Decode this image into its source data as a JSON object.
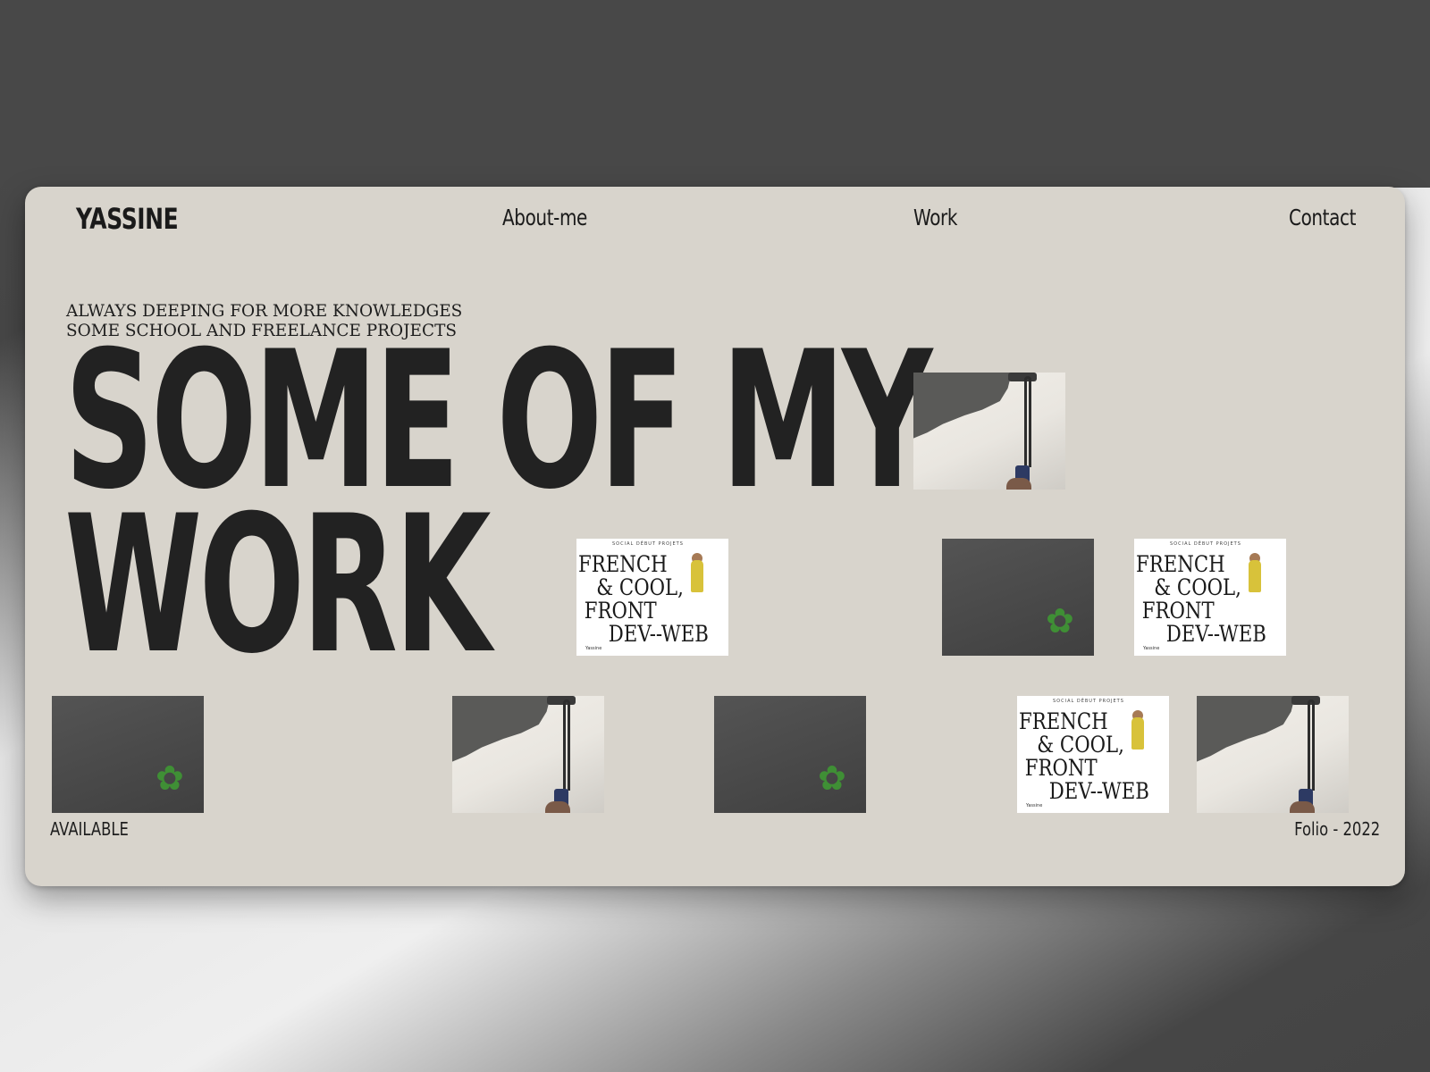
{
  "nav": {
    "logo": "YASSINE",
    "about": "About-me",
    "work": "Work",
    "contact": "Contact"
  },
  "hero": {
    "tagline_line1": "ALWAYS DEEPING FOR MORE KNOWLEDGES",
    "tagline_line2": "SOME SCHOOL AND FREELANCE PROJECTS",
    "headline_line1": "SOME OF MY",
    "headline_line2": "WORK"
  },
  "poster": {
    "mini_header": "SOCIAL   DÉBUT   PROJETS",
    "text": "FRENCH\n   & COOL,\n FRONT\n     DEV--WEB",
    "corner": "Yassine"
  },
  "thumbnails": [
    {
      "kind": "roller"
    },
    {
      "kind": "poster"
    },
    {
      "kind": "dark"
    },
    {
      "kind": "poster"
    },
    {
      "kind": "dark"
    },
    {
      "kind": "roller"
    },
    {
      "kind": "dark"
    },
    {
      "kind": "poster"
    },
    {
      "kind": "roller"
    }
  ],
  "footer": {
    "status": "AVAILABLE",
    "folio": "Folio - 2022"
  },
  "colors": {
    "window_bg": "#d8d4cc",
    "text": "#1a1a1a",
    "outer_dark": "#484848"
  }
}
